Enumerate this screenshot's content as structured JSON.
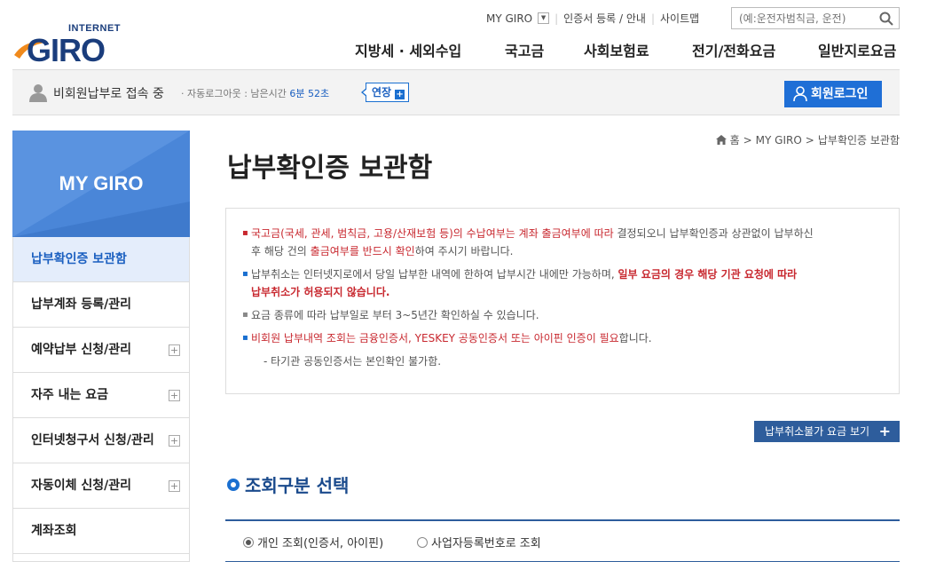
{
  "header": {
    "logo_top": "INTERNET",
    "logo_main": "GIRO",
    "util_links": [
      "MY GIRO",
      "인증서 등록 / 안내",
      "사이트맵"
    ],
    "search_placeholder": "(예:운전자범칙금, 운전)",
    "gnb": [
      "지방세 · 세외수입",
      "국고금",
      "사회보험료",
      "전기/전화요금",
      "일반지로요금"
    ]
  },
  "statusbar": {
    "guest_text": "비회원납부로 접속 중",
    "auto_logout_prefix": "자동로그아웃 : 남은시간",
    "remaining_time": "6분 52초",
    "extend_label": "연장",
    "login_label": "회원로그인"
  },
  "sidebar": {
    "title": "MY GIRO",
    "items": [
      {
        "label": "납부확인증 보관함",
        "active": true,
        "expandable": false
      },
      {
        "label": "납부계좌 등록/관리",
        "active": false,
        "expandable": false
      },
      {
        "label": "예약납부 신청/관리",
        "active": false,
        "expandable": true
      },
      {
        "label": "자주 내는 요금",
        "active": false,
        "expandable": true
      },
      {
        "label": "인터넷청구서 신청/관리",
        "active": false,
        "expandable": true
      },
      {
        "label": "자동이체 신청/관리",
        "active": false,
        "expandable": true
      },
      {
        "label": "계좌조회",
        "active": false,
        "expandable": false
      }
    ]
  },
  "breadcrumb": [
    "홈",
    "MY GIRO",
    "납부확인증 보관함"
  ],
  "page_title": "납부확인증 보관함",
  "notice": {
    "p1_red": "국고금(국세, 관세, 범칙금, 고용/산재보험 등)의 수납여부는 계좌 출금여부에 따라",
    "p1_rest": " 결정되오니 납부확인증과 상관없이 납부하신",
    "p1_line2_a": "후 해당 건의 ",
    "p1_line2_red": "출금여부를 반드시 확인",
    "p1_line2_b": "하여 주시기 바랍니다.",
    "p2_a": "납부취소는 인터넷지로에서 당일 납부한 내역에 한하여 납부시간 내에만 가능하며, ",
    "p2_bold": "일부 요금의 경우 해당 기관 요청에 따라",
    "p2_bold2": "납부취소가 허용되지 않습니다.",
    "p3": "요금 종류에 따라 납부일로 부터 3~5년간 확인하실 수 있습니다.",
    "p4_red": "비회원 납부내역 조회는 금융인증서, YESKEY 공동인증서 또는 아이핀 인증이 필요",
    "p4_rest": "합니다.",
    "p5": "- 타기관 공동인증서는 본인확인 불가함."
  },
  "nocancel_button": "납부취소불가 요금 보기",
  "section_title": "조회구분 선택",
  "options": [
    {
      "label": "개인 조회(인증서, 아이핀)",
      "selected": true
    },
    {
      "label": "사업자등록번호로 조회",
      "selected": false
    }
  ],
  "colors": {
    "accent": "#1f6fd6",
    "sidebar_head": "#4a86d8",
    "warning": "#c8282f",
    "navy": "#2e5d9c"
  }
}
